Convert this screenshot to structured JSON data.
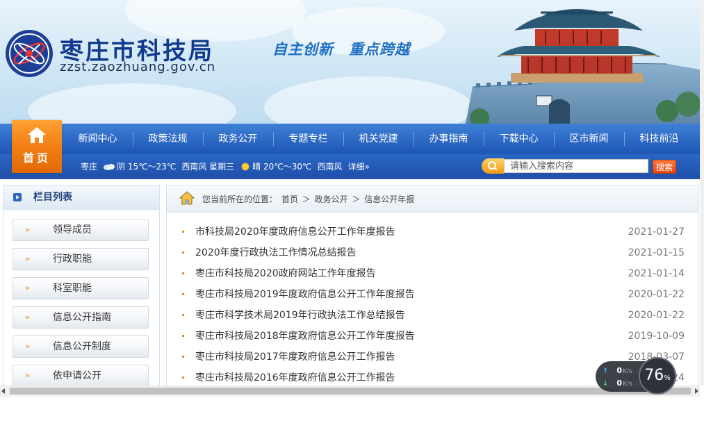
{
  "site": {
    "title": "枣庄市科技局",
    "domain": "zzst.zaozhuang.gov.cn",
    "slogan": "自主创新　重点跨越"
  },
  "nav": {
    "home": "首页",
    "items": [
      {
        "label": "新闻中心"
      },
      {
        "label": "政策法规"
      },
      {
        "label": "政务公开"
      },
      {
        "label": "专题专栏"
      },
      {
        "label": "机关党建"
      },
      {
        "label": "办事指南"
      },
      {
        "label": "下载中心"
      },
      {
        "label": "区市新闻"
      },
      {
        "label": "科技前沿"
      }
    ]
  },
  "weather": {
    "city": "枣庄",
    "today": "阴 15℃～23℃",
    "today_wind": "西南风 星期三",
    "tomorrow": "晴 20℃～30℃",
    "tomorrow_wind": "西南风",
    "detail": "详细»"
  },
  "search": {
    "placeholder": "请输入搜索内容",
    "button": "搜索"
  },
  "sidebar": {
    "title": "栏目列表",
    "items": [
      {
        "label": "领导成员"
      },
      {
        "label": "行政职能"
      },
      {
        "label": "科室职能"
      },
      {
        "label": "信息公开指南"
      },
      {
        "label": "信息公开制度"
      },
      {
        "label": "依申请公开"
      }
    ]
  },
  "breadcrumb": {
    "prefix": "您当前所在的位置：",
    "items": [
      "首页",
      "政务公开",
      "信息公开年报"
    ],
    "sep": "＞"
  },
  "articles": [
    {
      "title": "市科技局2020年度政府信息公开工作年度报告",
      "date": "2021-01-27"
    },
    {
      "title": "2020年度行政执法工作情况总结报告",
      "date": "2021-01-15"
    },
    {
      "title": "枣庄市科技局2020政府网站工作年度报告",
      "date": "2021-01-14"
    },
    {
      "title": "枣庄市科技局2019年度政府信息公开工作年度报告",
      "date": "2020-01-22"
    },
    {
      "title": "枣庄市科学技术局2019年行政执法工作总结报告",
      "date": "2020-01-22"
    },
    {
      "title": "枣庄市科技局2018年度政府信息公开工作年度报告",
      "date": "2019-10-09"
    },
    {
      "title": "枣庄市科技局2017年度政府信息公开工作报告",
      "date": "2018-03-07"
    },
    {
      "title": "枣庄市科技局2016年度政府信息公开工作报告",
      "date": "2017-02-24"
    }
  ],
  "speed_widget": {
    "up_value": "0",
    "up_unit": "K/s",
    "down_value": "0",
    "down_unit": "K/s",
    "percent": "76",
    "percent_sign": "%"
  },
  "colors": {
    "nav_blue": "#2a66c4",
    "home_orange": "#f07c12",
    "title_blue": "#123a8c",
    "bullet_orange": "#e88a1a"
  }
}
